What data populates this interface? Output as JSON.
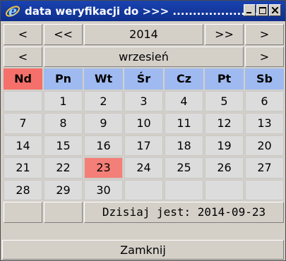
{
  "window": {
    "title": "data weryfikacji do >>> .......................",
    "icon": "internet-explorer-icon",
    "controls": [
      "minimize-icon",
      "maximize-icon",
      "close-icon"
    ]
  },
  "nav": {
    "prev_month": "<",
    "prev_year": "<<",
    "year": "2014",
    "next_year": ">>",
    "next_month": ">",
    "prev_month2": "<",
    "month": "wrzesień",
    "next_month2": ">"
  },
  "weekdays": [
    "Nd",
    "Pn",
    "Wt",
    "Śr",
    "Cz",
    "Pt",
    "Sb"
  ],
  "weeks": [
    [
      "",
      "1",
      "2",
      "3",
      "4",
      "5",
      "6"
    ],
    [
      "7",
      "8",
      "9",
      "10",
      "11",
      "12",
      "13"
    ],
    [
      "14",
      "15",
      "16",
      "17",
      "18",
      "19",
      "20"
    ],
    [
      "21",
      "22",
      "23",
      "24",
      "25",
      "26",
      "27"
    ],
    [
      "28",
      "29",
      "30",
      "",
      "",
      "",
      ""
    ]
  ],
  "today_label": "Dzisiaj jest: 2014-09-23",
  "close_label": "Zamknij",
  "colors": {
    "titlebar": "#1a43b0",
    "weekday_header": "#9fbaf0",
    "sunday_header": "#f5706a",
    "today_highlight": "#f47f78"
  }
}
